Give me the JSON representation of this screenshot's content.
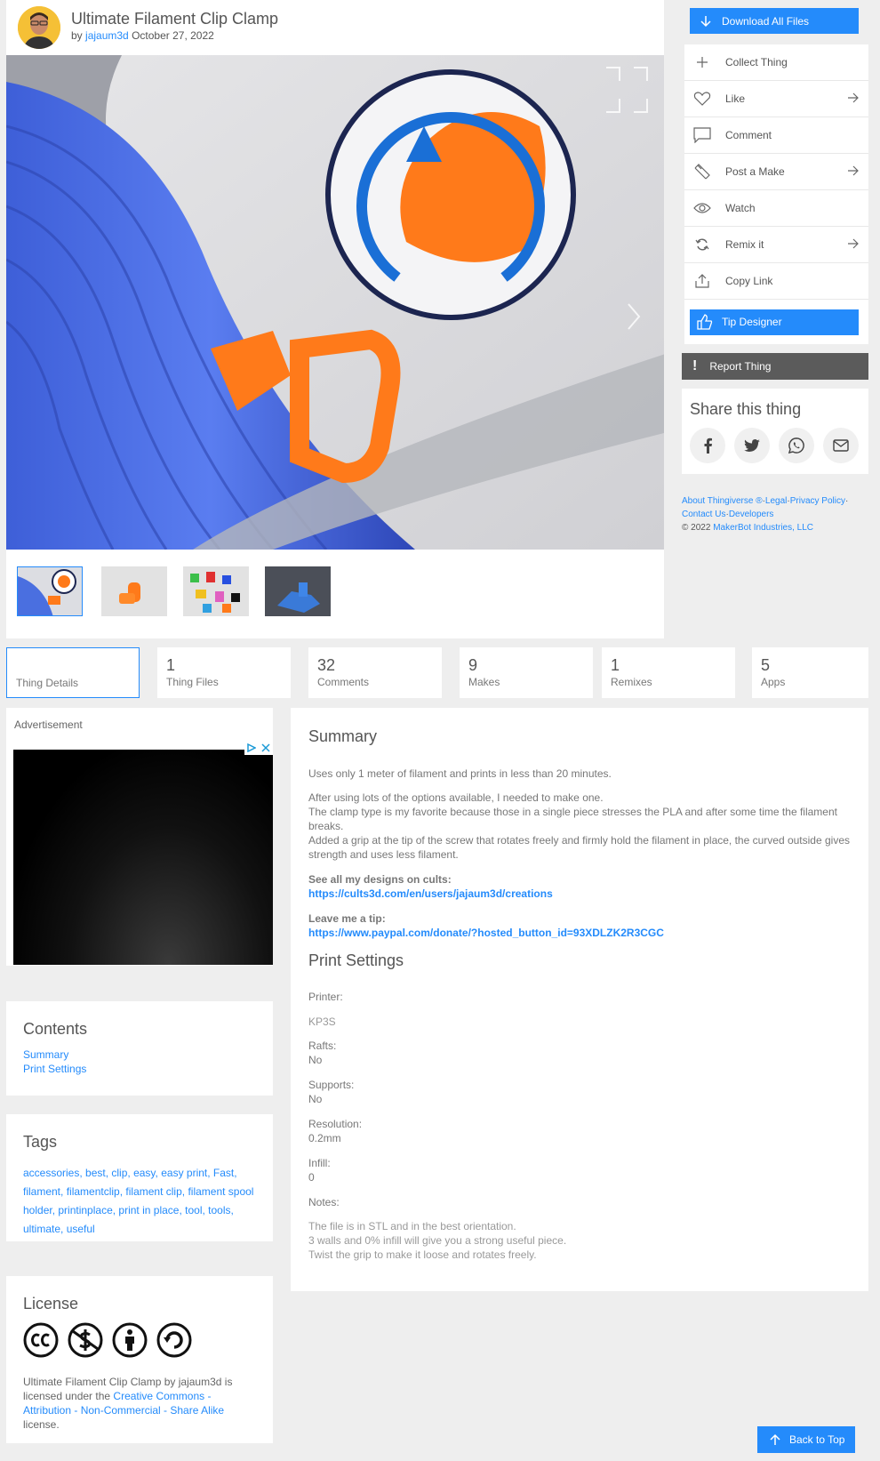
{
  "thing": {
    "title": "Ultimate Filament Clip Clamp",
    "by_prefix": "by",
    "author": "jajaum3d",
    "date": "October 27, 2022"
  },
  "sidebar": {
    "download": "Download All Files",
    "actions": [
      {
        "label": "Collect Thing",
        "icon": "plus-icon"
      },
      {
        "label": "Like",
        "icon": "heart-icon"
      },
      {
        "label": "Comment",
        "icon": "comment-icon"
      },
      {
        "label": "Post a Make",
        "icon": "post-make-icon"
      },
      {
        "label": "Watch",
        "icon": "eye-icon"
      },
      {
        "label": "Remix it",
        "icon": "remix-icon"
      },
      {
        "label": "Copy Link",
        "icon": "share-icon"
      }
    ],
    "tip": "Tip Designer",
    "report": "Report Thing",
    "share_title": "Share this thing",
    "footer": {
      "about": "About Thingiverse ®",
      "legal": "Legal",
      "privacy": "Privacy Policy",
      "contact": "Contact Us",
      "developers": "Developers",
      "copyright": "©  2022",
      "company": "MakerBot Industries, LLC"
    }
  },
  "tabs": [
    {
      "num": "",
      "label": "Thing Details"
    },
    {
      "num": "1",
      "label": "Thing Files"
    },
    {
      "num": "32",
      "label": "Comments"
    },
    {
      "num": "9",
      "label": "Makes"
    },
    {
      "num": "1",
      "label": "Remixes"
    },
    {
      "num": "5",
      "label": "Apps"
    }
  ],
  "ad": {
    "label": "Advertisement"
  },
  "contents": {
    "title": "Contents",
    "items": [
      "Summary",
      "Print Settings"
    ]
  },
  "tags": {
    "title": "Tags",
    "list": [
      "accessories",
      "best",
      "clip",
      "easy",
      "easy print",
      "Fast",
      "filament",
      "filamentclip",
      "filament clip",
      "filament spool holder",
      "printinplace",
      "print in place",
      "tool",
      "tools",
      "ultimate",
      "useful"
    ]
  },
  "license": {
    "title": "License",
    "thing": "Ultimate Filament Clip Clamp",
    "by": "by",
    "author": "jajaum3d",
    "is": "is licensed under the",
    "name": "Creative Commons - Attribution - Non-Commercial - Share Alike",
    "end": "license."
  },
  "summary": {
    "title": "Summary",
    "p1": "Uses only 1 meter of filament and prints in less than 20 minutes.",
    "p2a": "After using lots of the options available, I needed to make one.",
    "p2b": "The clamp type is my favorite because those in a single piece stresses the PLA and after some time the filament breaks.",
    "p2c": "Added a grip at the tip of the screw that rotates freely and firmly hold the filament in place, the curved outside gives strength and uses less filament.",
    "cults_label": "See all my designs on cults:",
    "cults_url": "https://cults3d.com/en/users/jajaum3d/creations",
    "tip_label": "Leave me a tip:",
    "tip_url": "https://www.paypal.com/donate/?hosted_button_id=93XDLZK2R3CGC"
  },
  "print_settings": {
    "title": "Print Settings",
    "printer_label": "Printer:",
    "printer": "KP3S",
    "rafts_label": "Rafts:",
    "rafts": "No",
    "supports_label": "Supports:",
    "supports": "No",
    "resolution_label": "Resolution:",
    "resolution": "0.2mm",
    "infill_label": "Infill:",
    "infill": "0",
    "notes_label": "Notes:",
    "note1": "The file is in STL and in the best orientation.",
    "note2": "3 walls and 0% infill will give you a strong useful piece.",
    "note3": "Twist the grip to make it loose and rotates freely."
  },
  "back_to_top": "Back to Top",
  "colors": {
    "accent": "#248bfb",
    "report": "#5b5b5b",
    "background": "#eeeeee"
  }
}
